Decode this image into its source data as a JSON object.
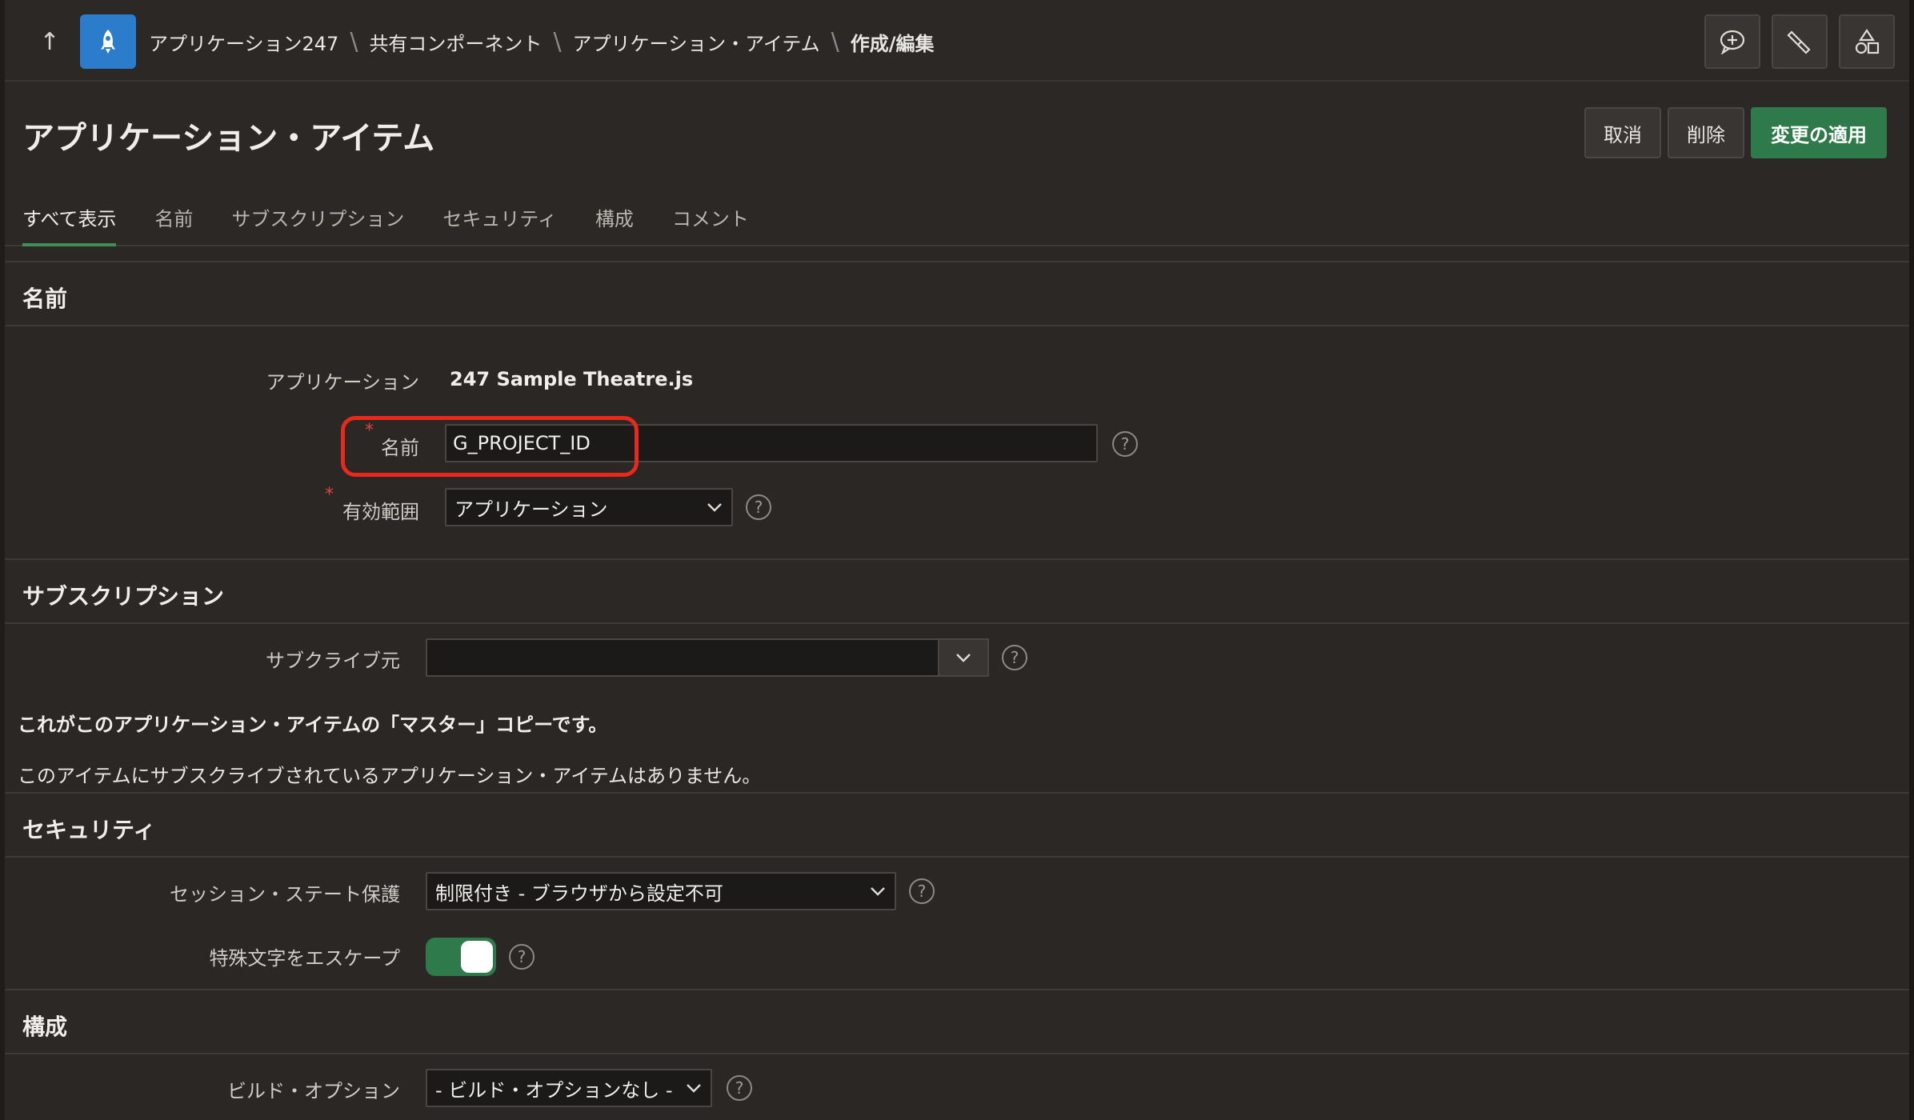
{
  "header": {
    "breadcrumb": [
      "アプリケーション247",
      "共有コンポーネント",
      "アプリケーション・アイテム",
      "作成/編集"
    ]
  },
  "titlebar": {
    "title": "アプリケーション・アイテム",
    "cancel_label": "取消",
    "delete_label": "削除",
    "apply_label": "変更の適用"
  },
  "tabs": [
    "すべて表示",
    "名前",
    "サブスクリプション",
    "セキュリティ",
    "構成",
    "コメント"
  ],
  "sections": {
    "name": {
      "title": "名前",
      "application_label": "アプリケーション",
      "application_value": "247 Sample Theatre.js",
      "name_label": "名前",
      "name_value": "G_PROJECT_ID",
      "scope_label": "有効範囲",
      "scope_value": "アプリケーション"
    },
    "subscription": {
      "title": "サブスクリプション",
      "subscribe_from_label": "サブクライブ元",
      "subscribe_from_value": "",
      "master_text": "これがこのアプリケーション・アイテムの「マスター」コピーです。",
      "no_subscribers_text": "このアイテムにサブスクライブされているアプリケーション・アイテムはありません。"
    },
    "security": {
      "title": "セキュリティ",
      "session_state_label": "セッション・ステート保護",
      "session_state_value": "制限付き - ブラウザから設定不可",
      "escape_label": "特殊文字をエスケープ",
      "escape_on": true
    },
    "config": {
      "title": "構成",
      "build_option_label": "ビルド・オプション",
      "build_option_value": "- ビルド・オプションなし -"
    }
  },
  "colors": {
    "accent_green": "#2e7a4a",
    "app_icon_blue": "#2b7dcc",
    "required_red": "#e0453f",
    "highlight_red": "#e8291c"
  }
}
